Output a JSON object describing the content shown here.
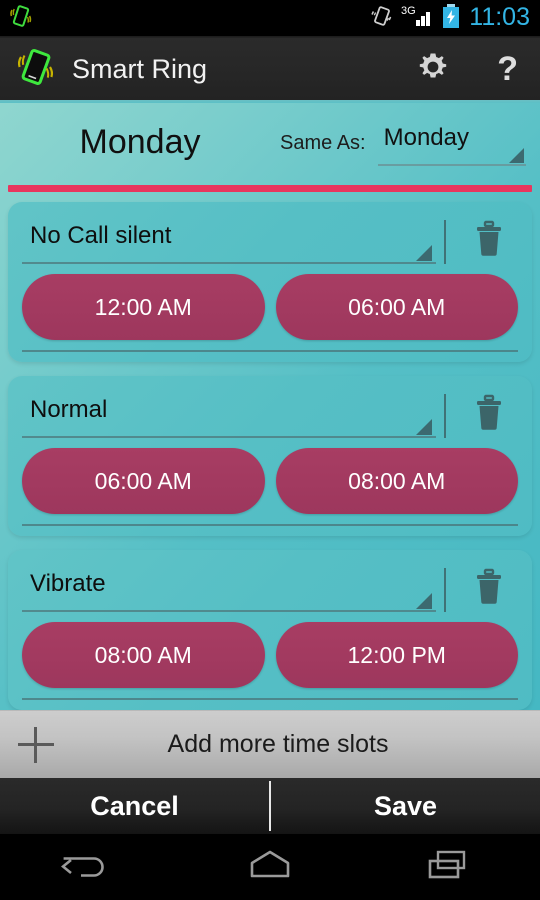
{
  "statusbar": {
    "notification_icon": "vibrating-phone-icon",
    "vibrate_icon": "vibrate-icon",
    "network_label": "3G",
    "signal_icon": "signal-bars-icon",
    "battery_icon": "battery-charging-icon",
    "time": "11:03",
    "time_color": "#33b5e5"
  },
  "actionbar": {
    "logo_icon": "vibrating-phone-logo",
    "title": "Smart Ring",
    "settings_icon": "gear-icon",
    "help_icon": "question-mark-icon",
    "help_label": "?"
  },
  "header": {
    "day_title": "Monday",
    "same_as_label": "Same As:",
    "same_as_value": "Monday",
    "accent_color": "#e8365e"
  },
  "slots": [
    {
      "mode": "No Call silent",
      "start_time": "12:00 AM",
      "end_time": "06:00 AM",
      "delete_icon": "trash-icon"
    },
    {
      "mode": "Normal",
      "start_time": "06:00 AM",
      "end_time": "08:00 AM",
      "delete_icon": "trash-icon"
    },
    {
      "mode": "Vibrate",
      "start_time": "08:00 AM",
      "end_time": "12:00 PM",
      "delete_icon": "trash-icon"
    }
  ],
  "addbar": {
    "plus_icon": "plus-icon",
    "label": "Add more time slots"
  },
  "buttonbar": {
    "cancel_label": "Cancel",
    "save_label": "Save"
  },
  "navbar": {
    "back_icon": "back-arrow-icon",
    "home_icon": "home-icon",
    "recents_icon": "recent-apps-icon"
  },
  "theme": {
    "card_teal": "#56bfc5",
    "time_button": "#a23d63",
    "accent_pink": "#e8365e"
  }
}
